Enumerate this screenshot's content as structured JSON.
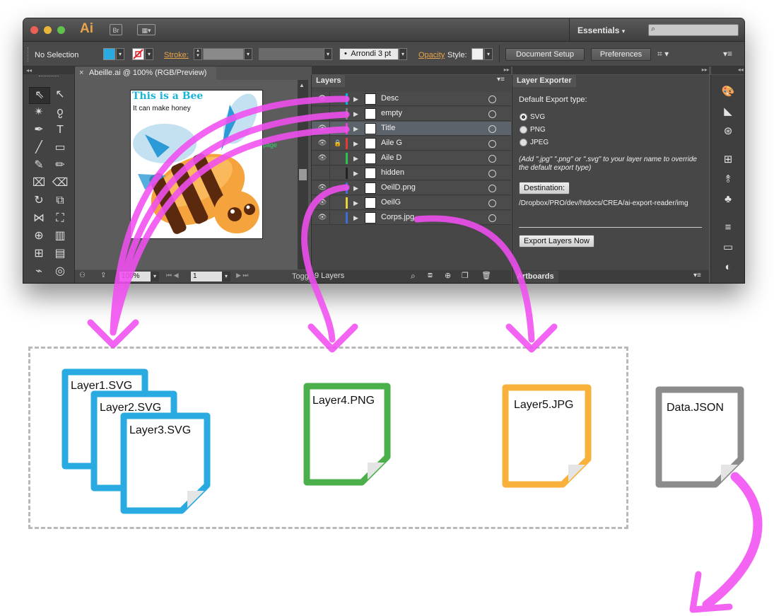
{
  "app": {
    "logo": "Ai",
    "bridge_button": "Br",
    "workspace": "Essentials",
    "search_placeholder": ""
  },
  "control_bar": {
    "selection": "No Selection",
    "stroke_label": "Stroke:",
    "brush": "Arrondi 3 pt",
    "opacity_label": "Opacity",
    "style_label": "Style:",
    "document_setup": "Document Setup",
    "preferences": "Preferences",
    "fill_color": "#29abe2"
  },
  "document": {
    "tab_title": "Abeille.ai @ 100% (RGB/Preview)",
    "artboard_title": "This is a Bee",
    "artboard_subtitle": "It can make honey",
    "page_label": "page",
    "zoom": "100%",
    "artboard_number": "1",
    "toggle_label": "Togg"
  },
  "layers_panel": {
    "title": "Layers",
    "footer": "9 Layers",
    "layers": [
      {
        "name": "Desc",
        "color": "#00b7e0",
        "visible": true,
        "locked": false
      },
      {
        "name": "empty",
        "color": "#7a7a7a",
        "visible": false,
        "locked": false
      },
      {
        "name": "Title",
        "color": "#e040d0",
        "visible": true,
        "locked": false
      },
      {
        "name": "Aile G",
        "color": "#e23b3b",
        "visible": true,
        "locked": true
      },
      {
        "name": "Aile D",
        "color": "#2ec44a",
        "visible": true,
        "locked": false
      },
      {
        "name": "hidden",
        "color": "#222222",
        "visible": false,
        "locked": false
      },
      {
        "name": "OeilD.png",
        "color": "#3c6fdc",
        "visible": true,
        "locked": false
      },
      {
        "name": "OeilG",
        "color": "#e6d43a",
        "visible": true,
        "locked": false
      },
      {
        "name": "Corps.jpg",
        "color": "#3c6fdc",
        "visible": true,
        "locked": false
      }
    ]
  },
  "exporter_panel": {
    "title": "Layer Exporter",
    "default_label": "Default Export type:",
    "options": [
      "SVG",
      "PNG",
      "JPEG"
    ],
    "selected": "SVG",
    "hint": "(Add \".jpg\" \".png\" or \".svg\" to your layer name to override the default export type)",
    "destination_button": "Destination:",
    "destination_path": "/Dropbox/PRO/dev/htdocs/CREA/ai-export-reader/img",
    "export_button": "Export Layers Now",
    "artboards_tab": "Artboards"
  },
  "files": {
    "svg_files": [
      "Layer1.SVG",
      "Layer2.SVG",
      "Layer3.SVG"
    ],
    "png_file": "Layer4.PNG",
    "jpg_file": "Layer5.JPG",
    "json_file": "Data.JSON",
    "svg_color": "#29abe2",
    "png_color": "#4bb04b",
    "jpg_color": "#f8b23b",
    "json_color": "#8c8c8c",
    "arrow_color": "#f24ff2"
  }
}
